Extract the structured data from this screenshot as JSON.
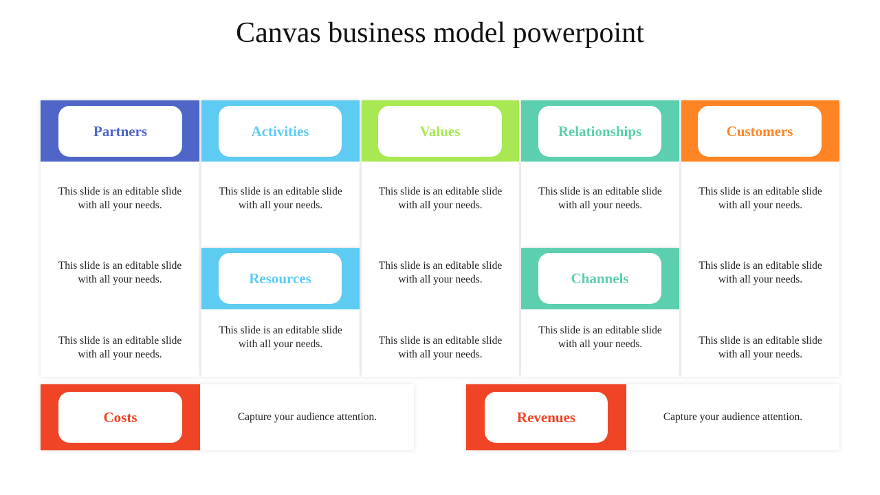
{
  "title": "Canvas business model powerpoint",
  "colors": {
    "partners": "#4F66C8",
    "activities": "#5ECBF2",
    "values": "#A7E853",
    "relationships": "#5CCFB0",
    "customers": "#FF8423",
    "costs": "#F04426"
  },
  "blocks": {
    "partners": {
      "label": "Partners",
      "texts": [
        "This slide is an editable slide with all your needs.",
        "This slide is an editable slide with all your needs.",
        "This slide is an editable slide with all your needs."
      ]
    },
    "activities": {
      "label": "Activities",
      "texts": [
        "This slide is an editable slide with all your needs."
      ]
    },
    "resources": {
      "label": "Resources",
      "texts": [
        "This slide is an editable slide with all your needs."
      ]
    },
    "values": {
      "label": "Values",
      "texts": [
        "This slide is an editable slide with all your needs.",
        "This slide is an editable slide with all your needs.",
        "This slide is an editable slide with all your needs."
      ]
    },
    "relationships": {
      "label": "Relationships",
      "texts": [
        "This slide is an editable slide with all your needs."
      ]
    },
    "channels": {
      "label": "Channels",
      "texts": [
        "This slide is an editable slide with all your needs."
      ]
    },
    "customers": {
      "label": "Customers",
      "texts": [
        "This slide is an editable slide with all your needs.",
        "This slide is an editable slide with all your needs.",
        "This slide is an editable slide with all your needs."
      ]
    },
    "costs": {
      "label": "Costs",
      "text": "Capture your audience attention."
    },
    "revenues": {
      "label": "Revenues",
      "text": "Capture your audience attention."
    }
  }
}
